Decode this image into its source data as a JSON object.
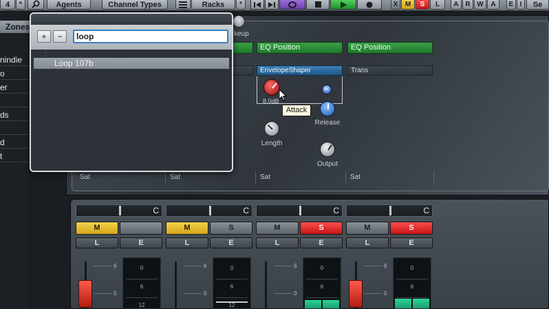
{
  "toolbar": {
    "agents_label": "Agents",
    "channel_types_label": "Channel Types",
    "racks_label": "Racks",
    "asterisk": "*",
    "left_asterisk": "*",
    "left_fragment": "4",
    "mode_buttons": [
      "X",
      "M",
      "S",
      "L"
    ],
    "rw_buttons": [
      "A",
      "R",
      "W",
      "A"
    ],
    "right_buttons": [
      "E",
      "I"
    ],
    "right_fragment": "Se"
  },
  "left_panel": {
    "tab_label": "Zones",
    "items": [
      "nindie",
      "o",
      "er",
      "",
      "ds",
      "",
      "d",
      "t"
    ]
  },
  "popup": {
    "search_value": "loop",
    "add_label": "+",
    "remove_label": "−",
    "result": "Loop 107b",
    "dots": ":"
  },
  "rack": {
    "makeup_fragment": "keup",
    "slots_green": [
      "EQ Position",
      "EQ Position"
    ],
    "slot_envelope": "EnvelopeShaper",
    "slot_trans": "Trans",
    "knob_value": "8.0dB",
    "sc_label": "sc",
    "knob_labels": {
      "release": "Release",
      "length": "Length",
      "output": "Output"
    },
    "tooltip": "Attack",
    "sat_labels": [
      "Sat",
      "Sat",
      "Sat",
      "Sat"
    ]
  },
  "mixer": {
    "pan_labels": [
      "C",
      "C",
      "C",
      "C"
    ],
    "channels": [
      {
        "m": "M",
        "s": "",
        "l": "L",
        "e": "E",
        "m_color": "yellow",
        "s_color": "gray"
      },
      {
        "m": "M",
        "s": "S",
        "l": "L",
        "e": "E",
        "m_color": "yellow",
        "s_color": "gray"
      },
      {
        "m": "M",
        "s": "S",
        "l": "L",
        "e": "E",
        "m_color": "gray",
        "s_color": "red"
      },
      {
        "m": "M",
        "s": "S",
        "l": "L",
        "e": "E",
        "m_color": "gray",
        "s_color": "red"
      }
    ],
    "fader_scale": [
      "6",
      "0"
    ],
    "meter_scale": [
      "0",
      "6",
      "12"
    ]
  },
  "colors": {
    "green_slot": "#2e8f3a",
    "blue_slot": "#2f6fa6",
    "solo_red": "#e02525",
    "mute_yellow": "#e8c030",
    "fader_red": "#d8352a",
    "meter_green": "#22c088"
  }
}
